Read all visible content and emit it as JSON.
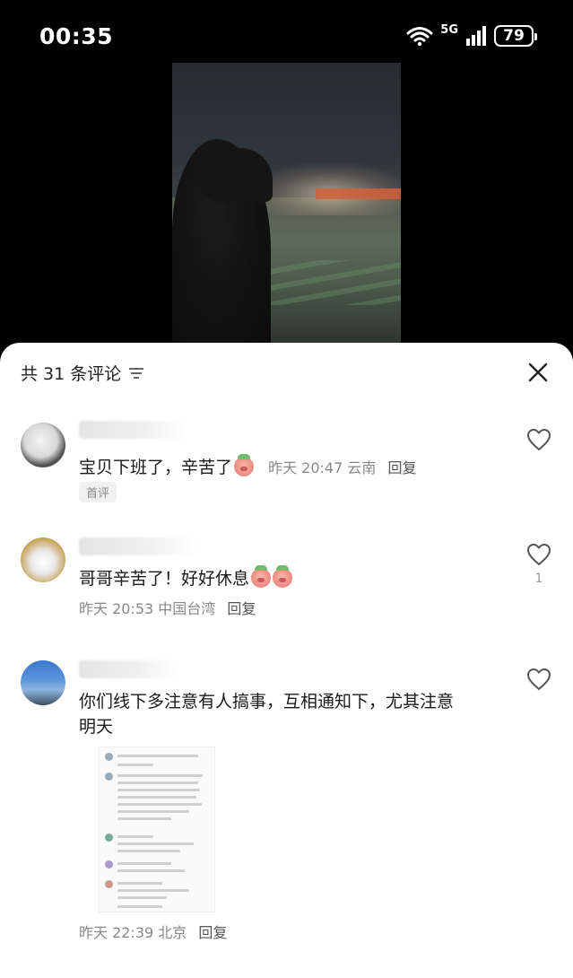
{
  "status_bar": {
    "time": "00:35",
    "network": "5G",
    "battery": "79"
  },
  "sheet": {
    "title": "共 31 条评论"
  },
  "comments": [
    {
      "text": "宝贝下班了，辛苦了",
      "time": "昨天 20:47",
      "location": "云南",
      "reply": "回复",
      "badge": "首评",
      "likes": ""
    },
    {
      "text": "哥哥辛苦了！好好休息",
      "time": "昨天 20:53",
      "location": "中国台湾",
      "reply": "回复",
      "likes": "1"
    },
    {
      "text_line1": "你们线下多注意有人搞事，互相通知下，尤其注意",
      "text_line2": "明天",
      "time": "昨天 22:39",
      "location": "北京",
      "reply": "回复",
      "likes": ""
    }
  ],
  "icons": {
    "wifi": "wifi-icon",
    "signal": "signal-icon",
    "filter": "filter-icon",
    "close": "close-icon",
    "like": "heart-icon"
  }
}
